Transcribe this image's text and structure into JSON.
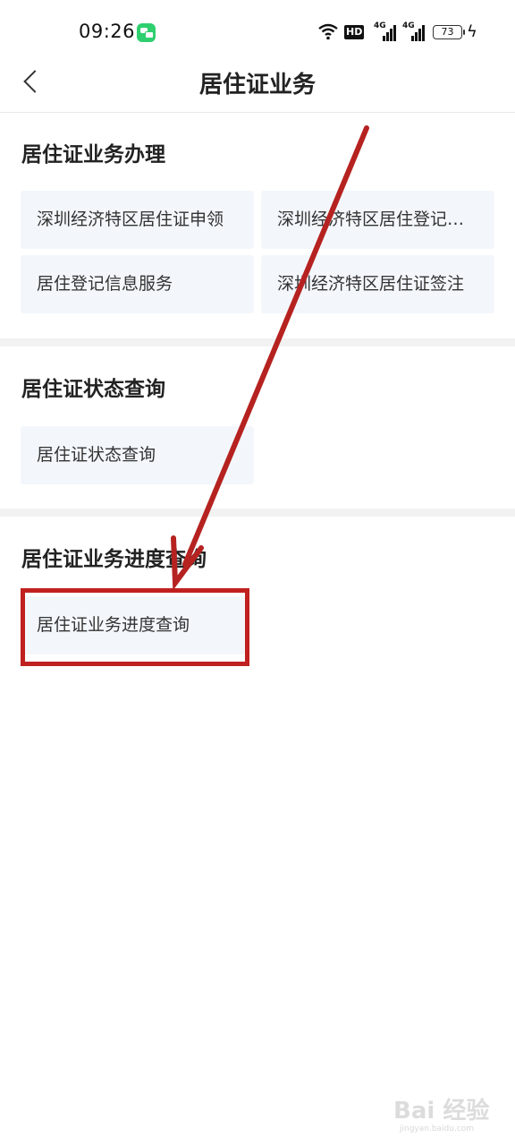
{
  "status_bar": {
    "time": "09:26",
    "hd_label": "HD",
    "network1": "4G",
    "network2": "4G",
    "battery": "73",
    "icons": [
      "message-app-icon",
      "wifi-icon",
      "hd-icon",
      "signal-icon",
      "signal-icon",
      "battery-icon",
      "charging-icon"
    ]
  },
  "header": {
    "back_icon": "back-arrow-icon",
    "title": "居住证业务"
  },
  "sections": [
    {
      "title": "居住证业务办理",
      "items": [
        "深圳经济特区居住证申领",
        "深圳经济特区居住登记…",
        "居住登记信息服务",
        "深圳经济特区居住证签注"
      ]
    },
    {
      "title": "居住证状态查询",
      "items": [
        "居住证状态查询"
      ]
    },
    {
      "title": "居住证业务进度查询",
      "items": [
        "居住证业务进度查询"
      ]
    }
  ],
  "annotation": {
    "color": "#c0201f",
    "highlighted_item": "居住证业务进度查询"
  },
  "watermark": {
    "text": "Bai 经验",
    "sub": "jingyan.baidu.com"
  },
  "colors": {
    "tile_bg": "#f3f7fb",
    "divider": "#f2f2f2",
    "text": "#222222"
  }
}
